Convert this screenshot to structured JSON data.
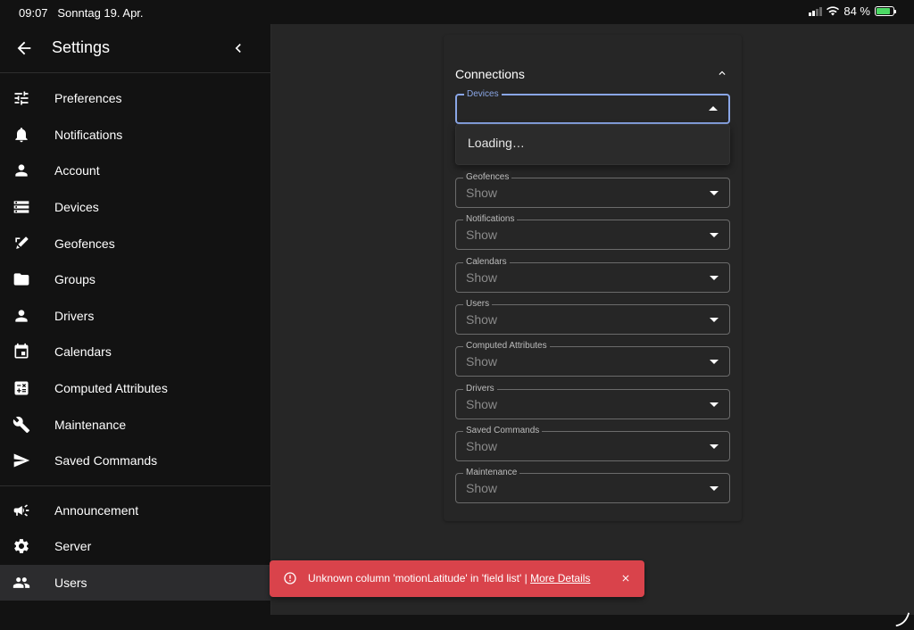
{
  "status_bar": {
    "time": "09:07",
    "date": "Sonntag 19. Apr.",
    "battery": "84 %"
  },
  "sidebar": {
    "title": "Settings",
    "items": [
      {
        "label": "Preferences",
        "icon": "tune-icon"
      },
      {
        "label": "Notifications",
        "icon": "bell-icon"
      },
      {
        "label": "Account",
        "icon": "person-icon"
      },
      {
        "label": "Devices",
        "icon": "storage-icon"
      },
      {
        "label": "Geofences",
        "icon": "draw-icon"
      },
      {
        "label": "Groups",
        "icon": "folder-icon"
      },
      {
        "label": "Drivers",
        "icon": "person-icon"
      },
      {
        "label": "Calendars",
        "icon": "calendar-icon"
      },
      {
        "label": "Computed Attributes",
        "icon": "calculate-icon"
      },
      {
        "label": "Maintenance",
        "icon": "wrench-icon"
      },
      {
        "label": "Saved Commands",
        "icon": "send-icon"
      }
    ],
    "admin_items": [
      {
        "label": "Announcement",
        "icon": "campaign-icon"
      },
      {
        "label": "Server",
        "icon": "gear-icon"
      },
      {
        "label": "Users",
        "icon": "people-icon",
        "active": true
      }
    ]
  },
  "connections": {
    "title": "Connections",
    "devices_label": "Devices",
    "loading_text": "Loading…",
    "fields": [
      {
        "label": "Geofences",
        "value": "Show"
      },
      {
        "label": "Notifications",
        "value": "Show"
      },
      {
        "label": "Calendars",
        "value": "Show"
      },
      {
        "label": "Users",
        "value": "Show"
      },
      {
        "label": "Computed Attributes",
        "value": "Show"
      },
      {
        "label": "Drivers",
        "value": "Show"
      },
      {
        "label": "Saved Commands",
        "value": "Show"
      },
      {
        "label": "Maintenance",
        "value": "Show"
      }
    ]
  },
  "snackbar": {
    "message": "Unknown column 'motionLatitude' in 'field list' | ",
    "link": "More Details"
  },
  "colors": {
    "error": "#d9434b",
    "focus": "#8aa6e6",
    "active_bg": "#2c2c2e"
  }
}
